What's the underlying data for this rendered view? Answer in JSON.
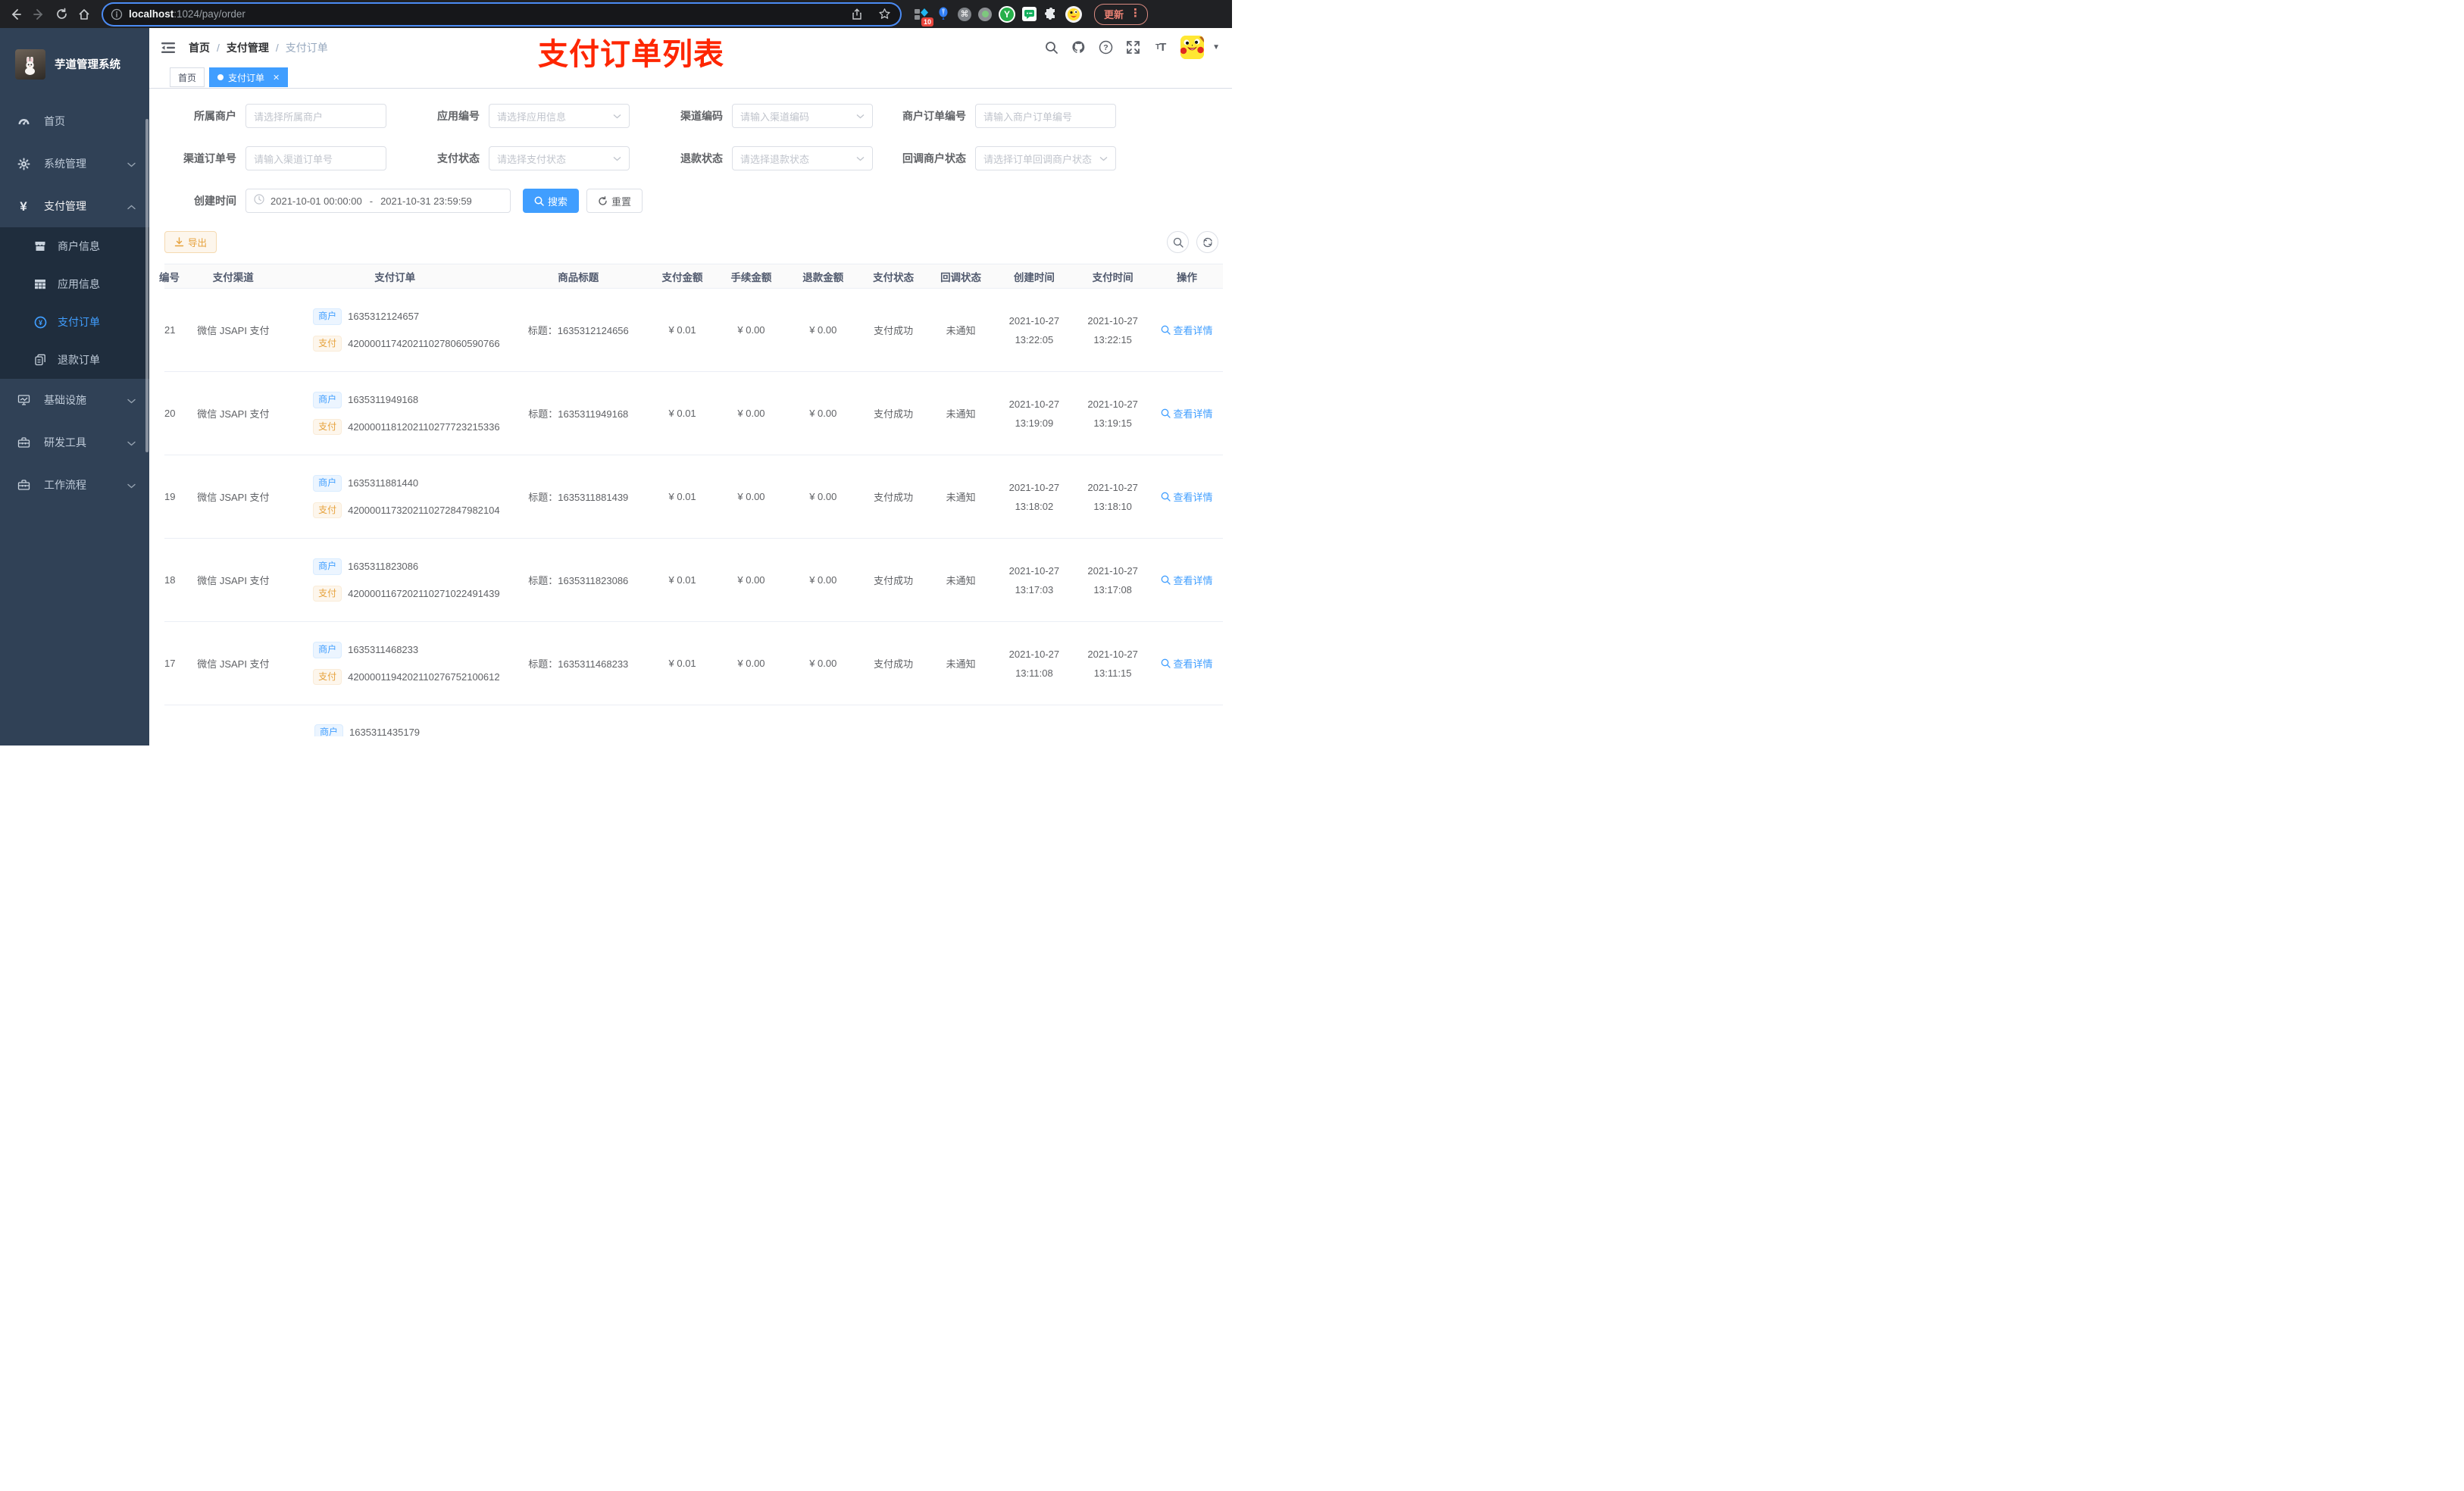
{
  "browser": {
    "url": {
      "host": "localhost",
      "path": ":1024/pay/order"
    },
    "update_label": "更新",
    "extension_badge": "10"
  },
  "sidebar": {
    "app_title": "芋道管理系统",
    "items": [
      {
        "label": "首页"
      },
      {
        "label": "系统管理"
      },
      {
        "label": "支付管理"
      },
      {
        "label": "商户信息"
      },
      {
        "label": "应用信息"
      },
      {
        "label": "支付订单"
      },
      {
        "label": "退款订单"
      },
      {
        "label": "基础设施"
      },
      {
        "label": "研发工具"
      },
      {
        "label": "工作流程"
      }
    ]
  },
  "topbar": {
    "breadcrumb": [
      "首页",
      "支付管理",
      "支付订单"
    ],
    "annotation_title": "支付订单列表"
  },
  "tabs": [
    {
      "label": "首页"
    },
    {
      "label": "支付订单"
    }
  ],
  "filters": {
    "fields": [
      {
        "label": "所属商户",
        "placeholder": "请选择所属商户"
      },
      {
        "label": "应用编号",
        "placeholder": "请选择应用信息"
      },
      {
        "label": "渠道编码",
        "placeholder": "请输入渠道编码"
      },
      {
        "label": "商户订单编号",
        "placeholder": "请输入商户订单编号"
      },
      {
        "label": "渠道订单号",
        "placeholder": "请输入渠道订单号"
      },
      {
        "label": "支付状态",
        "placeholder": "请选择支付状态"
      },
      {
        "label": "退款状态",
        "placeholder": "请选择退款状态"
      },
      {
        "label": "回调商户状态",
        "placeholder": "请选择订单回调商户状态"
      }
    ],
    "date": {
      "label": "创建时间",
      "start": "2021-10-01 00:00:00",
      "separator": "-",
      "end": "2021-10-31 23:59:59"
    },
    "search_label": "搜索",
    "reset_label": "重置"
  },
  "toolbar": {
    "export_label": "导出"
  },
  "table": {
    "columns": [
      "编号",
      "支付渠道",
      "支付订单",
      "商品标题",
      "支付金额",
      "手续金额",
      "退款金额",
      "支付状态",
      "回调状态",
      "创建时间",
      "支付时间",
      "操作"
    ],
    "tag_merchant": "商户",
    "tag_pay": "支付",
    "rows": [
      {
        "id": "21",
        "channel": "微信 JSAPI 支付",
        "merchant_no": "1635312124657",
        "pay_no": "4200001174202110278060590766",
        "title": "标题：1635312124656",
        "amount": "¥ 0.01",
        "fee": "¥ 0.00",
        "refund": "¥ 0.00",
        "pay_status": "支付成功",
        "notify_status": "未通知",
        "create_date": "2021-10-27",
        "create_time": "13:22:05",
        "pay_date": "2021-10-27",
        "pay_time": "13:22:15",
        "action": "查看详情"
      },
      {
        "id": "20",
        "channel": "微信 JSAPI 支付",
        "merchant_no": "1635311949168",
        "pay_no": "4200001181202110277723215336",
        "title": "标题：1635311949168",
        "amount": "¥ 0.01",
        "fee": "¥ 0.00",
        "refund": "¥ 0.00",
        "pay_status": "支付成功",
        "notify_status": "未通知",
        "create_date": "2021-10-27",
        "create_time": "13:19:09",
        "pay_date": "2021-10-27",
        "pay_time": "13:19:15",
        "action": "查看详情"
      },
      {
        "id": "19",
        "channel": "微信 JSAPI 支付",
        "merchant_no": "1635311881440",
        "pay_no": "4200001173202110272847982104",
        "title": "标题：1635311881439",
        "amount": "¥ 0.01",
        "fee": "¥ 0.00",
        "refund": "¥ 0.00",
        "pay_status": "支付成功",
        "notify_status": "未通知",
        "create_date": "2021-10-27",
        "create_time": "13:18:02",
        "pay_date": "2021-10-27",
        "pay_time": "13:18:10",
        "action": "查看详情"
      },
      {
        "id": "18",
        "channel": "微信 JSAPI 支付",
        "merchant_no": "1635311823086",
        "pay_no": "4200001167202110271022491439",
        "title": "标题：1635311823086",
        "amount": "¥ 0.01",
        "fee": "¥ 0.00",
        "refund": "¥ 0.00",
        "pay_status": "支付成功",
        "notify_status": "未通知",
        "create_date": "2021-10-27",
        "create_time": "13:17:03",
        "pay_date": "2021-10-27",
        "pay_time": "13:17:08",
        "action": "查看详情"
      },
      {
        "id": "17",
        "channel": "微信 JSAPI 支付",
        "merchant_no": "1635311468233",
        "pay_no": "4200001194202110276752100612",
        "title": "标题：1635311468233",
        "amount": "¥ 0.01",
        "fee": "¥ 0.00",
        "refund": "¥ 0.00",
        "pay_status": "支付成功",
        "notify_status": "未通知",
        "create_date": "2021-10-27",
        "create_time": "13:11:08",
        "pay_date": "2021-10-27",
        "pay_time": "13:11:15",
        "action": "查看详情"
      }
    ],
    "partial_row": {
      "merchant_no": "1635311435179"
    }
  }
}
